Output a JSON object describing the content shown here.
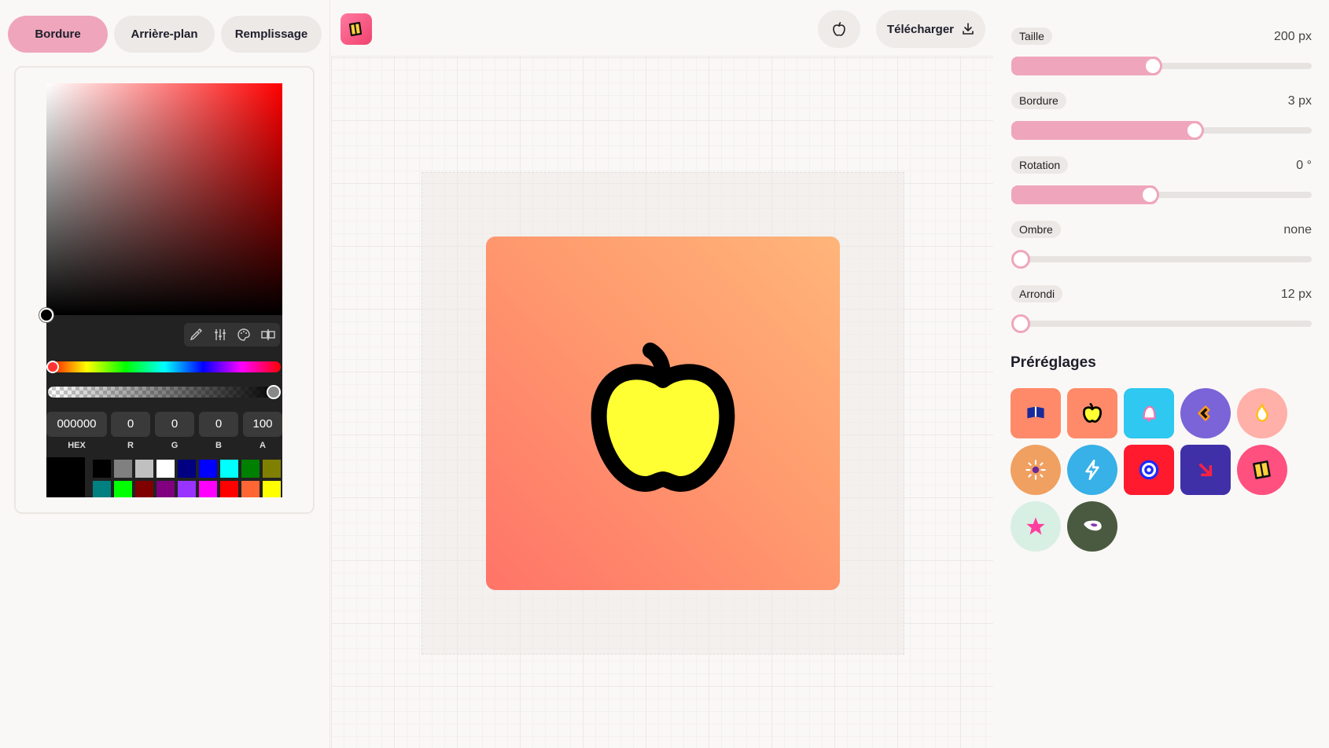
{
  "tabs": [
    "Bordure",
    "Arrière-plan",
    "Remplissage"
  ],
  "active_tab": "Bordure",
  "color_picker": {
    "hex": "000000",
    "r": "0",
    "g": "0",
    "b": "0",
    "a": "100",
    "labels": {
      "hex": "HEX",
      "r": "R",
      "g": "G",
      "b": "B",
      "a": "A"
    },
    "hue": "#ff0000",
    "tools": [
      "eyedropper-icon",
      "sliders-icon",
      "palette-icon",
      "compare-icon"
    ],
    "swatches": [
      "#000000",
      "#808080",
      "#c0c0c0",
      "#ffffff",
      "#000080",
      "#0000ff",
      "#00ffff",
      "#008000",
      "#808000",
      "#008080",
      "#00ff00",
      "#800000",
      "#800080",
      "#9933ff",
      "#ff00ff",
      "#ff0000",
      "#ff6633",
      "#ffff00"
    ]
  },
  "toolbar": {
    "download_label": "Télécharger"
  },
  "canvas": {
    "icon": "apple-icon",
    "background_gradient": [
      "#ff7468",
      "#ffb57a"
    ],
    "fill_color": "#ffff33",
    "border_color": "#000000"
  },
  "settings": [
    {
      "label": "Taille",
      "value": "200 px",
      "level": 0.47
    },
    {
      "label": "Bordure",
      "value": "3 px",
      "level": 0.61
    },
    {
      "label": "Rotation",
      "value": "0 °",
      "level": 0.46
    },
    {
      "label": "Ombre",
      "value": "none",
      "level": 0
    },
    {
      "label": "Arrondi",
      "value": "12 px",
      "level": 0
    }
  ],
  "presets": {
    "title": "Préréglages",
    "items": [
      {
        "icon": "book-icon",
        "bg": "#ff8a6a"
      },
      {
        "icon": "apple-icon",
        "bg": "#ff8a6a"
      },
      {
        "icon": "bell-icon",
        "bg": "#2ec8f0"
      },
      {
        "icon": "heart-icon",
        "bg": "#7a64d8"
      },
      {
        "icon": "flame-icon",
        "bg": "#ffb0a8"
      },
      {
        "icon": "sun-icon",
        "bg": "#f0a060"
      },
      {
        "icon": "bolt-icon",
        "bg": "#38b0e8"
      },
      {
        "icon": "target-icon",
        "bg": "#ff1a2e"
      },
      {
        "icon": "arrow-icon",
        "bg": "#4030a8"
      },
      {
        "icon": "notebook-icon",
        "bg": "#ff5080"
      },
      {
        "icon": "star-icon",
        "bg": "#d8f0e4"
      },
      {
        "icon": "shoe-icon",
        "bg": "#4a5a40"
      }
    ]
  }
}
